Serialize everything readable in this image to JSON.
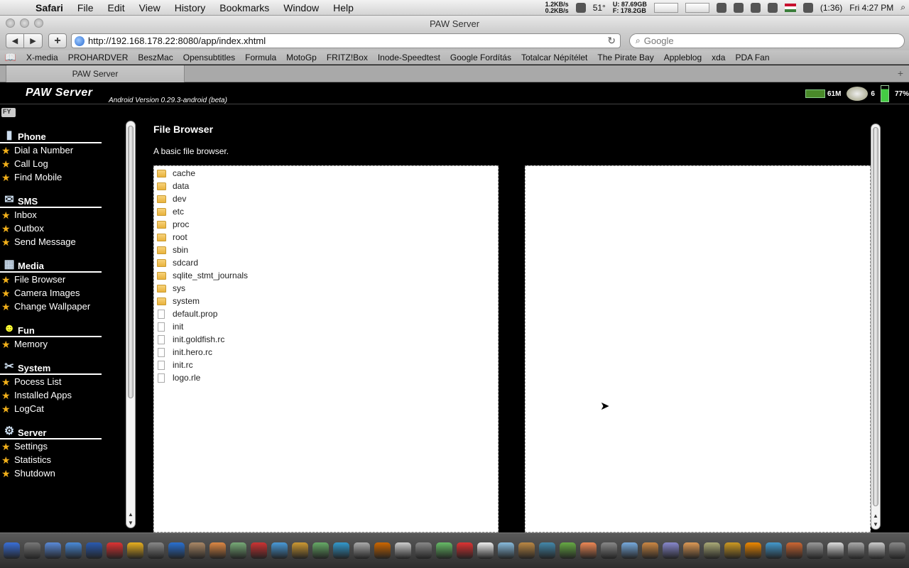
{
  "menubar": {
    "app": "Safari",
    "items": [
      "File",
      "Edit",
      "View",
      "History",
      "Bookmarks",
      "Window",
      "Help"
    ],
    "net_up": "1.2KB/s",
    "net_down": "0.2KB/s",
    "temp": "51°",
    "disk_used": "U: 87.69GB",
    "disk_free": "F: 178.2GB",
    "battery": "(1:36)",
    "clock": "Fri 4:27 PM"
  },
  "window": {
    "title": "PAW Server"
  },
  "toolbar": {
    "url": "http://192.168.178.22:8080/app/index.xhtml",
    "search_placeholder": "Google"
  },
  "bookmarks": [
    "X-media",
    "PROHARDVER",
    "BeszMac",
    "Opensubtitles",
    "Formula",
    "MotoGp",
    "FRITZ!Box",
    "Inode-Speedtest",
    "Google Fordítás",
    "Totalcar Népítélet",
    "The Pirate Bay",
    "Appleblog",
    "xda",
    "PDA Fan"
  ],
  "tabs": [
    {
      "label": "PAW Server"
    }
  ],
  "paw": {
    "title": "PAW Server",
    "version": "Android Version 0.29.3-android (beta)",
    "memory": "61M",
    "volume": "6",
    "battery": "77%",
    "fy": "FY"
  },
  "sidebar": {
    "categories": [
      {
        "label": "Phone",
        "icon": "phone-icon",
        "items": [
          "Dial a Number",
          "Call Log",
          "Find Mobile"
        ]
      },
      {
        "label": "SMS",
        "icon": "sms-icon",
        "items": [
          "Inbox",
          "Outbox",
          "Send Message"
        ]
      },
      {
        "label": "Media",
        "icon": "media-icon",
        "items": [
          "File Browser",
          "Camera Images",
          "Change Wallpaper"
        ]
      },
      {
        "label": "Fun",
        "icon": "smiley-icon",
        "items": [
          "Memory"
        ]
      },
      {
        "label": "System",
        "icon": "tools-icon",
        "items": [
          "Pocess List",
          "Installed Apps",
          "LogCat"
        ]
      },
      {
        "label": "Server",
        "icon": "gear-icon",
        "items": [
          "Settings",
          "Statistics",
          "Shutdown"
        ]
      }
    ]
  },
  "main": {
    "title": "File Browser",
    "description": "A basic file browser.",
    "files": [
      {
        "name": "cache",
        "type": "folder"
      },
      {
        "name": "data",
        "type": "folder"
      },
      {
        "name": "dev",
        "type": "folder"
      },
      {
        "name": "etc",
        "type": "folder"
      },
      {
        "name": "proc",
        "type": "folder"
      },
      {
        "name": "root",
        "type": "folder"
      },
      {
        "name": "sbin",
        "type": "folder"
      },
      {
        "name": "sdcard",
        "type": "folder"
      },
      {
        "name": "sqlite_stmt_journals",
        "type": "folder"
      },
      {
        "name": "sys",
        "type": "folder"
      },
      {
        "name": "system",
        "type": "folder"
      },
      {
        "name": "default.prop",
        "type": "file"
      },
      {
        "name": "init",
        "type": "file"
      },
      {
        "name": "init.goldfish.rc",
        "type": "file"
      },
      {
        "name": "init.hero.rc",
        "type": "file"
      },
      {
        "name": "init.rc",
        "type": "file"
      },
      {
        "name": "logo.rle",
        "type": "file"
      }
    ]
  },
  "colors": {
    "page_bg": "#000000",
    "star": "#f2b01a",
    "folder": "#e9b23c"
  }
}
